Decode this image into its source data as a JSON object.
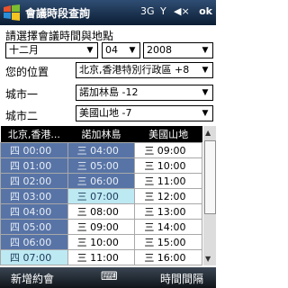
{
  "titlebar": {
    "title": "會議時段查詢",
    "network": "3G",
    "signal": "Y",
    "volume": "◀×",
    "ok": "ok"
  },
  "form": {
    "heading": "請選擇會議時間與地點",
    "month": "十二月",
    "day": "04",
    "year": "2008",
    "your_location_label": "您的位置",
    "your_location_value": "北京,香港特別行政區 +8",
    "city1_label": "城市一",
    "city1_value": "諾加林島 -12",
    "city2_label": "城市二",
    "city2_value": "美國山地 -7"
  },
  "table": {
    "headers": [
      "北京,香港...",
      "諾加林島",
      "美國山地"
    ],
    "rows": [
      [
        "四 00:00",
        "三 04:00",
        "三 09:00"
      ],
      [
        "四 01:00",
        "三 05:00",
        "三 10:00"
      ],
      [
        "四 02:00",
        "三 06:00",
        "三 11:00"
      ],
      [
        "四 03:00",
        "三 07:00",
        "三 12:00"
      ],
      [
        "四 04:00",
        "三 08:00",
        "三 13:00"
      ],
      [
        "四 05:00",
        "三 09:00",
        "三 14:00"
      ],
      [
        "四 06:00",
        "三 10:00",
        "三 15:00"
      ],
      [
        "四 07:00",
        "三 11:00",
        "三 16:00"
      ]
    ]
  },
  "bottombar": {
    "left": "新增約會",
    "mid": "⌨",
    "right": "時間間隔"
  }
}
